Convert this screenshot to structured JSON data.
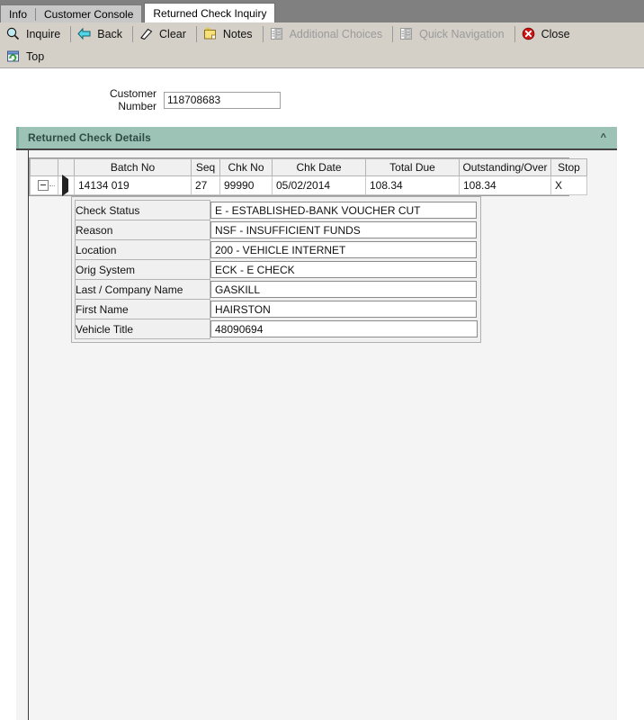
{
  "window": {
    "tabs": [
      {
        "label": "Info",
        "active": false
      },
      {
        "label": "Customer Console",
        "active": false
      },
      {
        "label": "Returned Check Inquiry",
        "active": true
      }
    ]
  },
  "toolbar": {
    "row1": [
      {
        "label": "Inquire",
        "icon": "magnifier-icon",
        "disabled": false
      },
      {
        "label": "Back",
        "icon": "back-arrow-icon",
        "disabled": false
      },
      {
        "label": "Clear",
        "icon": "eraser-icon",
        "disabled": false
      },
      {
        "label": "Notes",
        "icon": "notes-icon",
        "disabled": false
      },
      {
        "label": "Additional Choices",
        "icon": "list-icon",
        "disabled": true
      },
      {
        "label": "Quick Navigation",
        "icon": "list-icon",
        "disabled": true
      },
      {
        "label": "Close",
        "icon": "close-circle-icon",
        "disabled": false
      }
    ],
    "row2": [
      {
        "label": "Top",
        "icon": "top-window-icon",
        "disabled": false
      }
    ]
  },
  "form": {
    "customer_number_label": "Customer Number",
    "customer_number_value": "118708683",
    "customer_number_placeholder": ""
  },
  "section": {
    "title": "Returned Check Details",
    "collapse_glyph": "«",
    "header_color": "#9cc3b5",
    "header_text_color": "#2e4b44"
  },
  "grid": {
    "columns": [
      "Batch No",
      "Seq",
      "Chk No",
      "Chk Date",
      "Total Due",
      "Outstanding/Over",
      "Stop"
    ],
    "rows": [
      {
        "batch_no": "14134 019",
        "seq": "27",
        "chk_no": "99990",
        "chk_date": "05/02/2014",
        "total_due": "108.34",
        "outstanding_over": "108.34",
        "stop": "X"
      }
    ]
  },
  "detail": {
    "fields": [
      {
        "label": "Check Status",
        "value": "E - ESTABLISHED-BANK VOUCHER CUT"
      },
      {
        "label": "Reason",
        "value": "NSF - INSUFFICIENT FUNDS"
      },
      {
        "label": "Location",
        "value": "200 - VEHICLE INTERNET"
      },
      {
        "label": "Orig System",
        "value": "ECK - E CHECK"
      },
      {
        "label": "Last / Company Name",
        "value": "GASKILL"
      },
      {
        "label": "First Name",
        "value": "HAIRSTON"
      },
      {
        "label": "Vehicle Title",
        "value": "48090694"
      }
    ]
  }
}
